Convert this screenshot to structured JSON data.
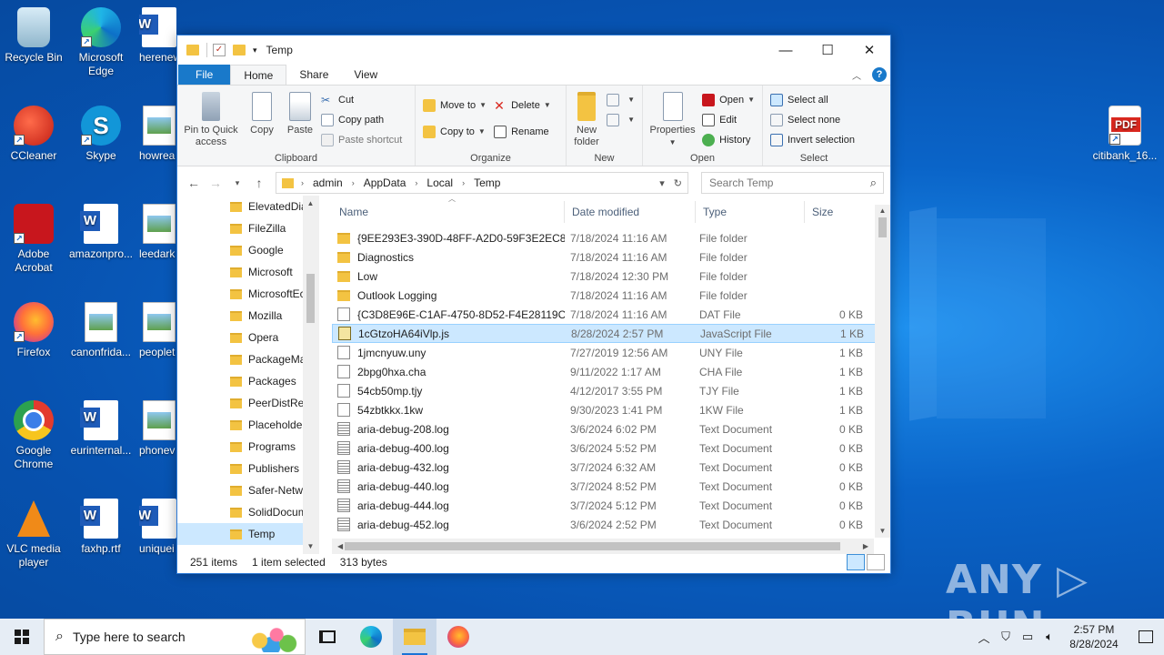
{
  "desktop": {
    "icons": [
      {
        "label": "Recycle Bin"
      },
      {
        "label": "Microsoft Edge"
      },
      {
        "label": "herenew"
      },
      {
        "label": "CCleaner"
      },
      {
        "label": "Skype"
      },
      {
        "label": "howrea"
      },
      {
        "label": "Adobe Acrobat"
      },
      {
        "label": "amazonpro..."
      },
      {
        "label": "leedark"
      },
      {
        "label": "Firefox"
      },
      {
        "label": "canonfrida..."
      },
      {
        "label": "peoplet"
      },
      {
        "label": "Google Chrome"
      },
      {
        "label": "eurinternal..."
      },
      {
        "label": "phonev"
      },
      {
        "label": "VLC media player"
      },
      {
        "label": "faxhp.rtf"
      },
      {
        "label": "uniquei"
      },
      {
        "label": "citibank_16..."
      }
    ],
    "icon_glyphs": {
      "word": "W",
      "skype": "S",
      "pdf": "PDF",
      "shortcut": "↗"
    }
  },
  "window": {
    "title": "Temp",
    "controls": {
      "minimize": "—",
      "maximize": "☐",
      "close": "✕"
    },
    "tabs": {
      "file": "File",
      "home": "Home",
      "share": "Share",
      "view": "View"
    },
    "ribbon": {
      "clipboard": {
        "pin": "Pin to Quick access",
        "copy": "Copy",
        "paste": "Paste",
        "cut": "Cut",
        "copy_path": "Copy path",
        "paste_shortcut": "Paste shortcut",
        "label": "Clipboard"
      },
      "organize": {
        "move_to": "Move to",
        "copy_to": "Copy to",
        "delete": "Delete",
        "rename": "Rename",
        "label": "Organize"
      },
      "new": {
        "new_folder": "New folder",
        "label": "New"
      },
      "open": {
        "properties": "Properties",
        "open": "Open",
        "edit": "Edit",
        "history": "History",
        "label": "Open"
      },
      "select": {
        "select_all": "Select all",
        "select_none": "Select none",
        "invert": "Invert selection",
        "label": "Select"
      }
    },
    "address": {
      "crumbs": [
        "admin",
        "AppData",
        "Local",
        "Temp"
      ],
      "search_placeholder": "Search Temp"
    },
    "tree": [
      "ElevatedDia",
      "FileZilla",
      "Google",
      "Microsoft",
      "MicrosoftEc",
      "Mozilla",
      "Opera",
      "PackageMa",
      "Packages",
      "PeerDistRep",
      "Placeholder",
      "Programs",
      "Publishers",
      "Safer-Netwo",
      "SolidDocum",
      "Temp"
    ],
    "columns": {
      "name": "Name",
      "date": "Date modified",
      "type": "Type",
      "size": "Size"
    },
    "files": [
      {
        "name": "{9EE293E3-390D-48FF-A2D0-59F3E2EC88...",
        "date": "7/18/2024 11:16 AM",
        "type": "File folder",
        "size": "",
        "icon": "folder"
      },
      {
        "name": "Diagnostics",
        "date": "7/18/2024 11:16 AM",
        "type": "File folder",
        "size": "",
        "icon": "folder"
      },
      {
        "name": "Low",
        "date": "7/18/2024 12:30 PM",
        "type": "File folder",
        "size": "",
        "icon": "folder"
      },
      {
        "name": "Outlook Logging",
        "date": "7/18/2024 11:16 AM",
        "type": "File folder",
        "size": "",
        "icon": "folder"
      },
      {
        "name": "{C3D8E96E-C1AF-4750-8D52-F4E28119C1...",
        "date": "7/18/2024 11:16 AM",
        "type": "DAT File",
        "size": "0 KB",
        "icon": "file"
      },
      {
        "name": "1cGtzoHA64iVlp.js",
        "date": "8/28/2024 2:57 PM",
        "type": "JavaScript File",
        "size": "1 KB",
        "icon": "js"
      },
      {
        "name": "1jmcnyuw.uny",
        "date": "7/27/2019 12:56 AM",
        "type": "UNY File",
        "size": "1 KB",
        "icon": "file"
      },
      {
        "name": "2bpg0hxa.cha",
        "date": "9/11/2022 1:17 AM",
        "type": "CHA File",
        "size": "1 KB",
        "icon": "file"
      },
      {
        "name": "54cb50mp.tjy",
        "date": "4/12/2017 3:55 PM",
        "type": "TJY File",
        "size": "1 KB",
        "icon": "file"
      },
      {
        "name": "54zbtkkx.1kw",
        "date": "9/30/2023 1:41 PM",
        "type": "1KW File",
        "size": "1 KB",
        "icon": "file"
      },
      {
        "name": "aria-debug-208.log",
        "date": "3/6/2024 6:02 PM",
        "type": "Text Document",
        "size": "0 KB",
        "icon": "text"
      },
      {
        "name": "aria-debug-400.log",
        "date": "3/6/2024 5:52 PM",
        "type": "Text Document",
        "size": "0 KB",
        "icon": "text"
      },
      {
        "name": "aria-debug-432.log",
        "date": "3/7/2024 6:32 AM",
        "type": "Text Document",
        "size": "0 KB",
        "icon": "text"
      },
      {
        "name": "aria-debug-440.log",
        "date": "3/7/2024 8:52 PM",
        "type": "Text Document",
        "size": "0 KB",
        "icon": "text"
      },
      {
        "name": "aria-debug-444.log",
        "date": "3/7/2024 5:12 PM",
        "type": "Text Document",
        "size": "0 KB",
        "icon": "text"
      },
      {
        "name": "aria-debug-452.log",
        "date": "3/6/2024 2:52 PM",
        "type": "Text Document",
        "size": "0 KB",
        "icon": "text"
      }
    ],
    "selected_file": "1cGtzoHA64iVlp.js",
    "status": {
      "count": "251 items",
      "selected": "1 item selected",
      "size": "313 bytes"
    }
  },
  "watermark": "ANY ▷ RUN",
  "taskbar": {
    "search_placeholder": "Type here to search",
    "time": "2:57 PM",
    "date": "8/28/2024",
    "tray_icons": [
      "chevron-up-icon",
      "network-icon",
      "speaker-icon"
    ]
  },
  "colors": {
    "accent": "#1979ca",
    "selection": "#cce8ff",
    "folder": "#f3c342",
    "desktop": "#0a64c8"
  }
}
